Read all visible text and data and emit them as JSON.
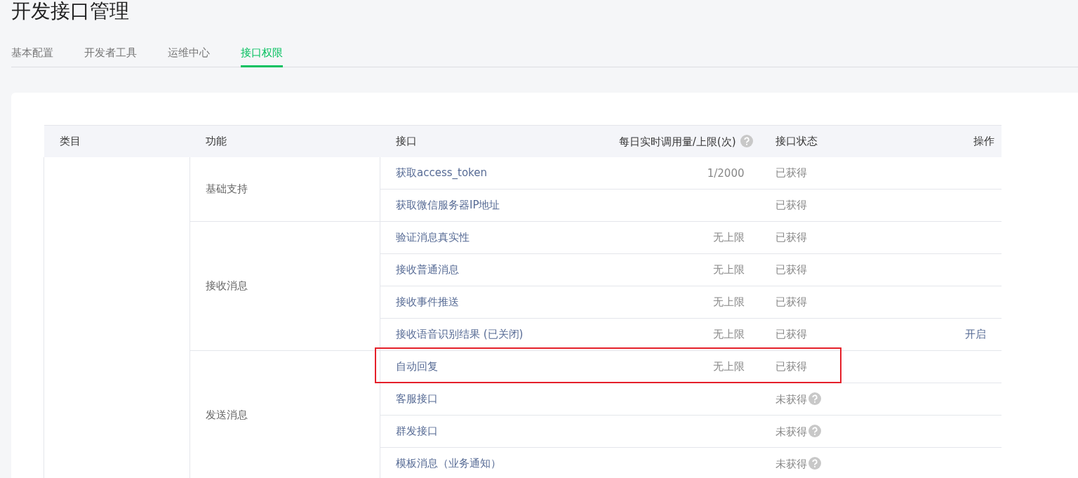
{
  "title": "开发接口管理",
  "tabs": [
    {
      "label": "基本配置",
      "selected": false
    },
    {
      "label": "开发者工具",
      "selected": false
    },
    {
      "label": "运维中心",
      "selected": false
    },
    {
      "label": "接口权限",
      "selected": true
    }
  ],
  "table": {
    "columns": [
      {
        "label": "类目",
        "help": false
      },
      {
        "label": "功能",
        "help": false
      },
      {
        "label": "接口",
        "help": false
      },
      {
        "label": "每日实时调用量/上限(次)",
        "help": true
      },
      {
        "label": "接口状态",
        "help": false
      },
      {
        "label": "操作",
        "help": false
      }
    ],
    "groups": [
      {
        "function": "基础支持",
        "rows": [
          {
            "api": "获取access_token",
            "quota": "1/2000",
            "status": "已获得",
            "status_help": false,
            "action": "",
            "highlighted": false
          },
          {
            "api": "获取微信服务器IP地址",
            "quota": "",
            "status": "已获得",
            "status_help": false,
            "action": "",
            "highlighted": false
          }
        ]
      },
      {
        "function": "接收消息",
        "rows": [
          {
            "api": "验证消息真实性",
            "quota": "无上限",
            "status": "已获得",
            "status_help": false,
            "action": "",
            "highlighted": false
          },
          {
            "api": "接收普通消息",
            "quota": "无上限",
            "status": "已获得",
            "status_help": false,
            "action": "",
            "highlighted": false
          },
          {
            "api": "接收事件推送",
            "quota": "无上限",
            "status": "已获得",
            "status_help": false,
            "action": "",
            "highlighted": false
          },
          {
            "api": "接收语音识别结果 (已关闭)",
            "quota": "无上限",
            "status": "已获得",
            "status_help": false,
            "action": "开启",
            "highlighted": false
          }
        ]
      },
      {
        "function": "发送消息",
        "rows": [
          {
            "api": "自动回复",
            "quota": "无上限",
            "status": "已获得",
            "status_help": false,
            "action": "",
            "highlighted": true
          },
          {
            "api": "客服接口",
            "quota": "",
            "status": "未获得",
            "status_help": true,
            "action": "",
            "highlighted": false
          },
          {
            "api": "群发接口",
            "quota": "",
            "status": "未获得",
            "status_help": true,
            "action": "",
            "highlighted": false
          },
          {
            "api": "模板消息（业务通知）",
            "quota": "",
            "status": "未获得",
            "status_help": true,
            "action": "",
            "highlighted": false
          }
        ]
      }
    ]
  }
}
